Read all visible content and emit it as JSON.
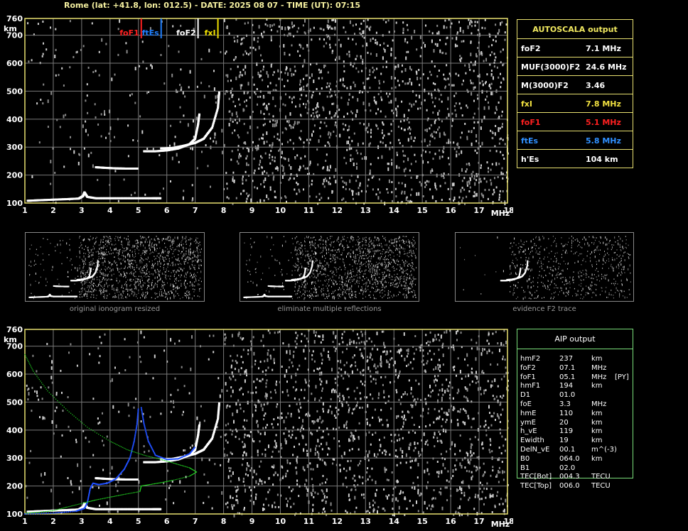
{
  "header": "Rome (lat: +41.8, lon: 012.5) - DATE: 2025 08 07 - TIME (UT): 07:15",
  "chart_data": [
    {
      "type": "scatter",
      "name_key": "top-ionogram",
      "xlabel": "MHz",
      "ylabel": "km",
      "xlim": [
        1,
        18
      ],
      "ylim": [
        100,
        760
      ],
      "x_ticks": [
        1,
        2,
        3,
        4,
        5,
        6,
        7,
        8,
        9,
        10,
        11,
        12,
        13,
        14,
        15,
        16,
        17,
        18
      ],
      "y_ticks": [
        100,
        200,
        300,
        400,
        500,
        600,
        700,
        760
      ],
      "grid": true,
      "markers": [
        {
          "label": "foF1",
          "x": 5.1,
          "color": "#ff2020"
        },
        {
          "label": "ftEs",
          "x": 5.8,
          "color": "#2080ff"
        },
        {
          "label": "foF2",
          "x": 7.1,
          "color": "#ffffff"
        },
        {
          "label": "fxI",
          "x": 7.8,
          "color": "#f0e000"
        }
      ],
      "series": [
        {
          "color": "#ffffff",
          "points": [
            [
              1.1,
              108
            ],
            [
              1.5,
              110
            ],
            [
              2.0,
              112
            ],
            [
              2.5,
              114
            ],
            [
              2.9,
              116
            ],
            [
              3.05,
              125
            ],
            [
              3.1,
              138
            ],
            [
              3.2,
              122
            ],
            [
              3.5,
              117
            ],
            [
              4.0,
              117
            ],
            [
              4.5,
              117
            ],
            [
              5.0,
              117
            ],
            [
              5.5,
              117
            ],
            [
              5.8,
              117
            ]
          ]
        },
        {
          "color": "#ffffff",
          "points": [
            [
              3.5,
              228
            ],
            [
              3.8,
              226
            ],
            [
              4.2,
              224
            ],
            [
              4.6,
              223
            ],
            [
              5.0,
              223
            ]
          ]
        },
        {
          "color": "#ffffff",
          "points": [
            [
              5.2,
              285
            ],
            [
              5.6,
              285
            ],
            [
              6.0,
              288
            ],
            [
              6.4,
              295
            ],
            [
              6.8,
              310
            ],
            [
              7.0,
              330
            ],
            [
              7.1,
              380
            ],
            [
              7.15,
              420
            ]
          ]
        },
        {
          "color": "#ffffff",
          "points": [
            [
              5.8,
              295
            ],
            [
              6.2,
              297
            ],
            [
              6.6,
              305
            ],
            [
              7.0,
              315
            ],
            [
              7.3,
              330
            ],
            [
              7.6,
              370
            ],
            [
              7.8,
              440
            ],
            [
              7.85,
              500
            ]
          ]
        }
      ]
    },
    {
      "type": "scatter",
      "name_key": "bottom-ionogram",
      "xlabel": "MHz",
      "ylabel": "km",
      "xlim": [
        1,
        18
      ],
      "ylim": [
        100,
        760
      ],
      "x_ticks": [
        1,
        2,
        3,
        4,
        5,
        6,
        7,
        8,
        9,
        10,
        11,
        12,
        13,
        14,
        15,
        16,
        17,
        18
      ],
      "y_ticks": [
        100,
        200,
        300,
        400,
        500,
        600,
        700,
        760
      ],
      "grid": true,
      "series": [
        {
          "color": "#ffffff",
          "points": [
            [
              1.1,
              108
            ],
            [
              1.5,
              110
            ],
            [
              2.0,
              112
            ],
            [
              2.5,
              114
            ],
            [
              2.9,
              116
            ],
            [
              3.05,
              125
            ],
            [
              3.1,
              138
            ],
            [
              3.2,
              122
            ],
            [
              3.5,
              117
            ],
            [
              4.0,
              117
            ],
            [
              4.5,
              117
            ],
            [
              5.0,
              117
            ],
            [
              5.5,
              117
            ],
            [
              5.8,
              117
            ]
          ]
        },
        {
          "color": "#ffffff",
          "points": [
            [
              3.5,
              228
            ],
            [
              3.8,
              226
            ],
            [
              4.2,
              224
            ],
            [
              4.6,
              223
            ],
            [
              5.0,
              223
            ]
          ]
        },
        {
          "color": "#ffffff",
          "points": [
            [
              5.2,
              285
            ],
            [
              5.6,
              285
            ],
            [
              6.0,
              288
            ],
            [
              6.4,
              295
            ],
            [
              6.8,
              310
            ],
            [
              7.0,
              330
            ],
            [
              7.1,
              380
            ],
            [
              7.15,
              420
            ]
          ]
        },
        {
          "color": "#ffffff",
          "points": [
            [
              5.8,
              295
            ],
            [
              6.2,
              297
            ],
            [
              6.6,
              305
            ],
            [
              7.0,
              315
            ],
            [
              7.3,
              330
            ],
            [
              7.6,
              370
            ],
            [
              7.8,
              440
            ],
            [
              7.85,
              500
            ]
          ]
        },
        {
          "color": "#2050ff",
          "points": [
            [
              1.0,
              100
            ],
            [
              2.0,
              103
            ],
            [
              2.8,
              110
            ],
            [
              3.1,
              120
            ],
            [
              3.2,
              140
            ],
            [
              3.3,
              190
            ],
            [
              3.4,
              210
            ],
            [
              3.6,
              205
            ],
            [
              3.9,
              210
            ],
            [
              4.2,
              225
            ],
            [
              4.5,
              260
            ],
            [
              4.7,
              300
            ],
            [
              4.85,
              360
            ],
            [
              4.95,
              420
            ],
            [
              5.0,
              480
            ]
          ]
        },
        {
          "color": "#2050ff",
          "points": [
            [
              5.1,
              480
            ],
            [
              5.2,
              420
            ],
            [
              5.35,
              360
            ],
            [
              5.6,
              310
            ],
            [
              6.0,
              295
            ],
            [
              6.4,
              297
            ],
            [
              6.8,
              315
            ],
            [
              7.0,
              340
            ]
          ]
        },
        {
          "color": "#20d020",
          "points": [
            [
              1.0,
              670
            ],
            [
              1.3,
              610
            ],
            [
              1.8,
              540
            ],
            [
              2.5,
              470
            ],
            [
              3.2,
              410
            ],
            [
              4.0,
              360
            ],
            [
              4.6,
              330
            ],
            [
              5.2,
              310
            ],
            [
              5.8,
              295
            ],
            [
              6.3,
              280
            ],
            [
              6.8,
              265
            ],
            [
              7.05,
              250
            ],
            [
              6.8,
              235
            ],
            [
              6.2,
              220
            ],
            [
              5.8,
              212
            ],
            [
              5.4,
              205
            ],
            [
              5.1,
              200
            ],
            [
              5.05,
              180
            ],
            [
              4.5,
              170
            ],
            [
              4.0,
              160
            ],
            [
              3.5,
              150
            ],
            [
              3.1,
              140
            ],
            [
              2.5,
              125
            ],
            [
              2.0,
              112
            ],
            [
              1.5,
              106
            ],
            [
              1.0,
              103
            ]
          ]
        }
      ]
    }
  ],
  "autoscala": {
    "title": "AUTOSCALA output",
    "rows": [
      {
        "label": "foF2",
        "value": "7.1 MHz",
        "color": "#ffffff"
      },
      {
        "label": "MUF(3000)F2",
        "value": "24.6 MHz",
        "color": "#ffffff"
      },
      {
        "label": "M(3000)F2",
        "value": "3.46",
        "color": "#ffffff"
      },
      {
        "label": "fxI",
        "value": "7.8 MHz",
        "color": "#f0e040"
      },
      {
        "label": "foF1",
        "value": "5.1 MHz",
        "color": "#ff2020"
      },
      {
        "label": "ftEs",
        "value": "5.8 MHz",
        "color": "#3090ff"
      },
      {
        "label": "h'Es",
        "value": "104 km",
        "color": "#ffffff"
      }
    ]
  },
  "thumbnails": [
    {
      "caption": "original ionogram resized"
    },
    {
      "caption": "eliminate multiple reflections"
    },
    {
      "caption": "evidence F2 trace"
    }
  ],
  "aip": {
    "title": "AIP output",
    "rows": [
      {
        "label": "hmF2",
        "value": "237",
        "unit": "km",
        "extra": ""
      },
      {
        "label": "foF2",
        "value": "07.1",
        "unit": "MHz",
        "extra": ""
      },
      {
        "label": "foF1",
        "value": "05.1",
        "unit": "MHz",
        "extra": "[PY]"
      },
      {
        "label": "hmF1",
        "value": "194",
        "unit": "km",
        "extra": ""
      },
      {
        "label": "D1",
        "value": "01.0",
        "unit": "",
        "extra": ""
      },
      {
        "label": "foE",
        "value": "3.3",
        "unit": "MHz",
        "extra": ""
      },
      {
        "label": "hmE",
        "value": "110",
        "unit": "km",
        "extra": ""
      },
      {
        "label": "ymE",
        "value": "20",
        "unit": "km",
        "extra": ""
      },
      {
        "label": "h_vE",
        "value": "119",
        "unit": "km",
        "extra": ""
      },
      {
        "label": "Ewidth",
        "value": "19",
        "unit": "km",
        "extra": ""
      },
      {
        "label": "DelN_vE",
        "value": "00.1",
        "unit": "m^(-3)",
        "extra": ""
      },
      {
        "label": "B0",
        "value": "064.0",
        "unit": "km",
        "extra": ""
      },
      {
        "label": "B1",
        "value": "02.0",
        "unit": "",
        "extra": ""
      },
      {
        "label": "TEC[Bot]",
        "value": "004.3",
        "unit": "TECU",
        "extra": ""
      },
      {
        "label": "TEC[Top]",
        "value": "006.0",
        "unit": "TECU",
        "extra": ""
      }
    ]
  }
}
